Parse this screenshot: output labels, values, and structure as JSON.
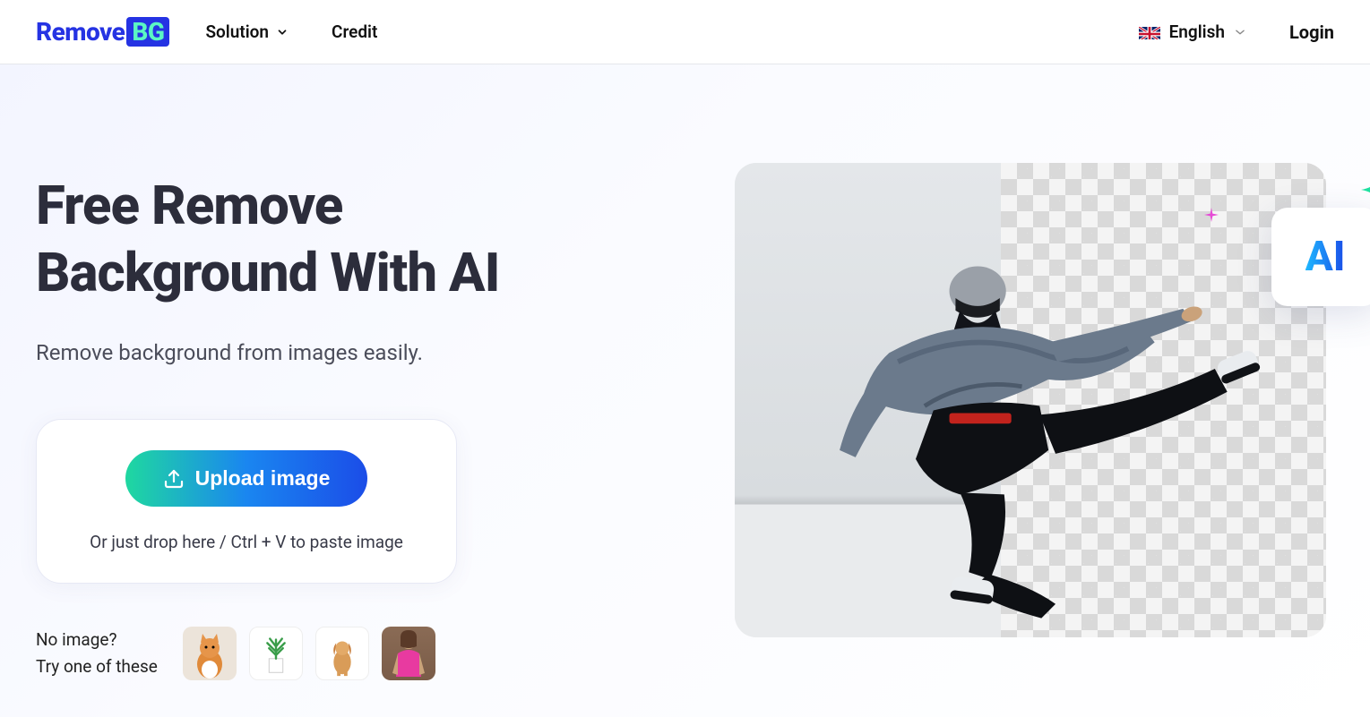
{
  "logo": {
    "prefix": "Remove",
    "box": "BG"
  },
  "nav": {
    "solution": "Solution",
    "credit": "Credit"
  },
  "header": {
    "language": "English",
    "login": "Login"
  },
  "hero": {
    "title_line1": "Free Remove",
    "title_line2": "Background With AI",
    "subtitle": "Remove background from images easily.",
    "upload_label": "Upload image",
    "drop_hint": "Or just drop here / Ctrl + V to paste image",
    "no_image_line1": "No image?",
    "no_image_line2": "Try one of these",
    "ai_badge": "AI"
  }
}
